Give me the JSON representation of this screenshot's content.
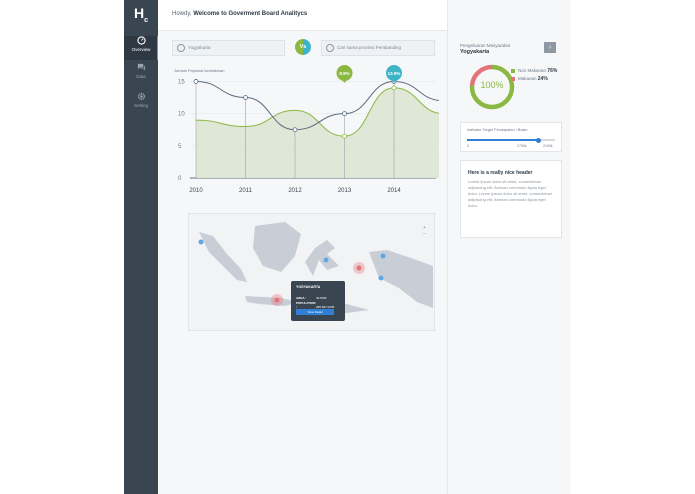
{
  "app": {
    "logo": "H",
    "logo_sub": "c"
  },
  "nav": [
    {
      "id": "overview",
      "label": "Overview",
      "icon": "dashboard-icon",
      "active": true
    },
    {
      "id": "data",
      "label": "Data",
      "icon": "chat-icon",
      "active": false
    },
    {
      "id": "setting",
      "label": "Setting",
      "icon": "gear-icon",
      "active": false
    }
  ],
  "header": {
    "greeting": "Howdy,",
    "title": "Welcome to Goverment Board Analitycs"
  },
  "compare": {
    "left_value": "Yogyakarta",
    "vs_label": "Vs",
    "right_placeholder": "Cari nama provinsi Pembanding"
  },
  "chart_data": {
    "type": "line",
    "title": "Jumlah Populasi kemiskinan",
    "x": [
      "2010",
      "2011",
      "2012",
      "2013",
      "2014"
    ],
    "ylim": [
      0,
      16
    ],
    "yticks": [
      "0",
      "5",
      "10",
      "15"
    ],
    "series": [
      {
        "values": [
          15,
          12.5,
          7.5,
          10,
          15,
          12
        ],
        "color": "#5b6b80"
      },
      {
        "values": [
          9,
          8,
          10.5,
          6.5,
          14,
          10
        ],
        "color": "#8ab842"
      }
    ],
    "annotations": [
      {
        "x": "2013",
        "label": "8.9%",
        "color": "#8ab842"
      },
      {
        "x": "2014",
        "label": "13.9%",
        "color": "#3fb4c9"
      }
    ]
  },
  "map": {
    "zoom_in": "+",
    "zoom_out": "−",
    "tooltip": {
      "city": "YOGYAKARTA",
      "area_label": "AREA :",
      "area_value": "32.5KM",
      "population_label": "POPULATION :",
      "population_value": "285.827.0235",
      "button": "View Detail"
    }
  },
  "panel": {
    "subtitle": "Pengeluaran Masyarakat",
    "city": "Yogyakarta",
    "next_icon": "chevron-right-icon",
    "donut_label": "100%",
    "legend": [
      {
        "label": "Non Makanan",
        "value": "76%",
        "color": "#8ab842"
      },
      {
        "label": "Makanan",
        "value": "24%",
        "color": "#e5737a"
      }
    ],
    "donut_values": [
      76,
      24
    ]
  },
  "slider": {
    "title": "Indikator Target Pendapatan / Bulan",
    "min": "0",
    "current": "1700k",
    "max": "2100k",
    "progress": 0.81
  },
  "info_card": {
    "heading": "Here is a really nice header",
    "body": "Lorem ipsum dolor sit amet, consectetuer adipiscing elit. Aenean commodo ligula eget dolor. Lorem ipsum dolor sit amet, consectetuer adipiscing elit. Aenean commodo ligula eget dolor."
  }
}
